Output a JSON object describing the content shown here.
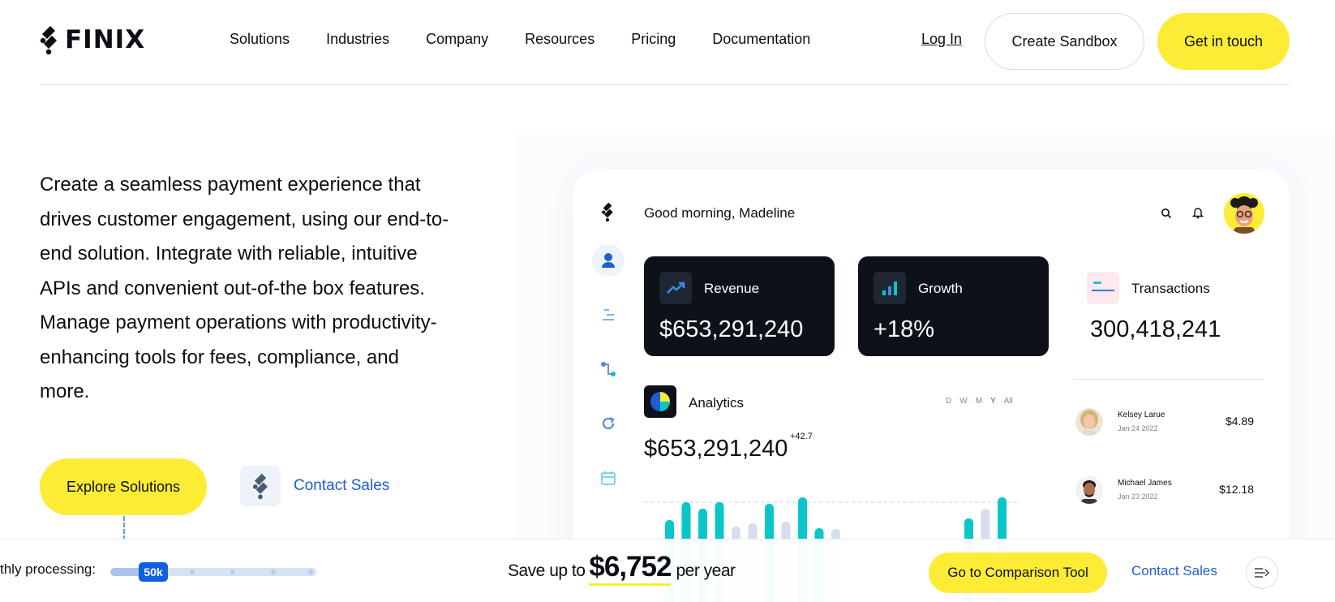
{
  "brand": {
    "name": "FINIX"
  },
  "nav": {
    "links": [
      "Solutions",
      "Industries",
      "Company",
      "Resources",
      "Pricing",
      "Documentation"
    ],
    "login": "Log In",
    "create_sandbox": "Create Sandbox",
    "get_in_touch": "Get in touch"
  },
  "hero": {
    "text": "Create a seamless payment experience that drives customer engagement, using our end-to-end solution. Integrate with reliable, intuitive APIs and convenient out-of-the box features. Manage payment operations with productivity-enhancing tools for fees, compliance, and more.",
    "explore": "Explore Solutions",
    "contact_sales": "Contact Sales"
  },
  "dashboard": {
    "greeting": "Good morning, Madeline",
    "revenue": {
      "label": "Revenue",
      "value": "$653,291,240"
    },
    "growth": {
      "label": "Growth",
      "value": "+18%"
    },
    "transactions": {
      "label": "Transactions",
      "value": "300,418,241"
    },
    "transaction_list": [
      {
        "name": "Kelsey Larue",
        "date": "Jan 24 2022",
        "amount": "$4.89"
      },
      {
        "name": "Michael James",
        "date": "Jan 23 2022",
        "amount": "$12.18"
      }
    ],
    "analytics": {
      "label": "Analytics",
      "periods": [
        "D",
        "W",
        "M",
        "Y",
        "All"
      ],
      "selected_period": "Y",
      "value": "$653,291,240",
      "delta": "+42.7"
    }
  },
  "bottom_bar": {
    "processing_label": "thly processing:",
    "slider_value": "50k",
    "slider_level": 0.18,
    "save_prefix": "Save up to",
    "save_amount": "$6,752",
    "save_suffix": "per year",
    "compare_button": "Go to Comparison Tool",
    "contact_sales": "Contact Sales"
  },
  "colors": {
    "accent_yellow": "#fdec35",
    "link_blue": "#1c5fd1",
    "dark_card": "#0d1119",
    "teal": "#0bc6c8"
  }
}
